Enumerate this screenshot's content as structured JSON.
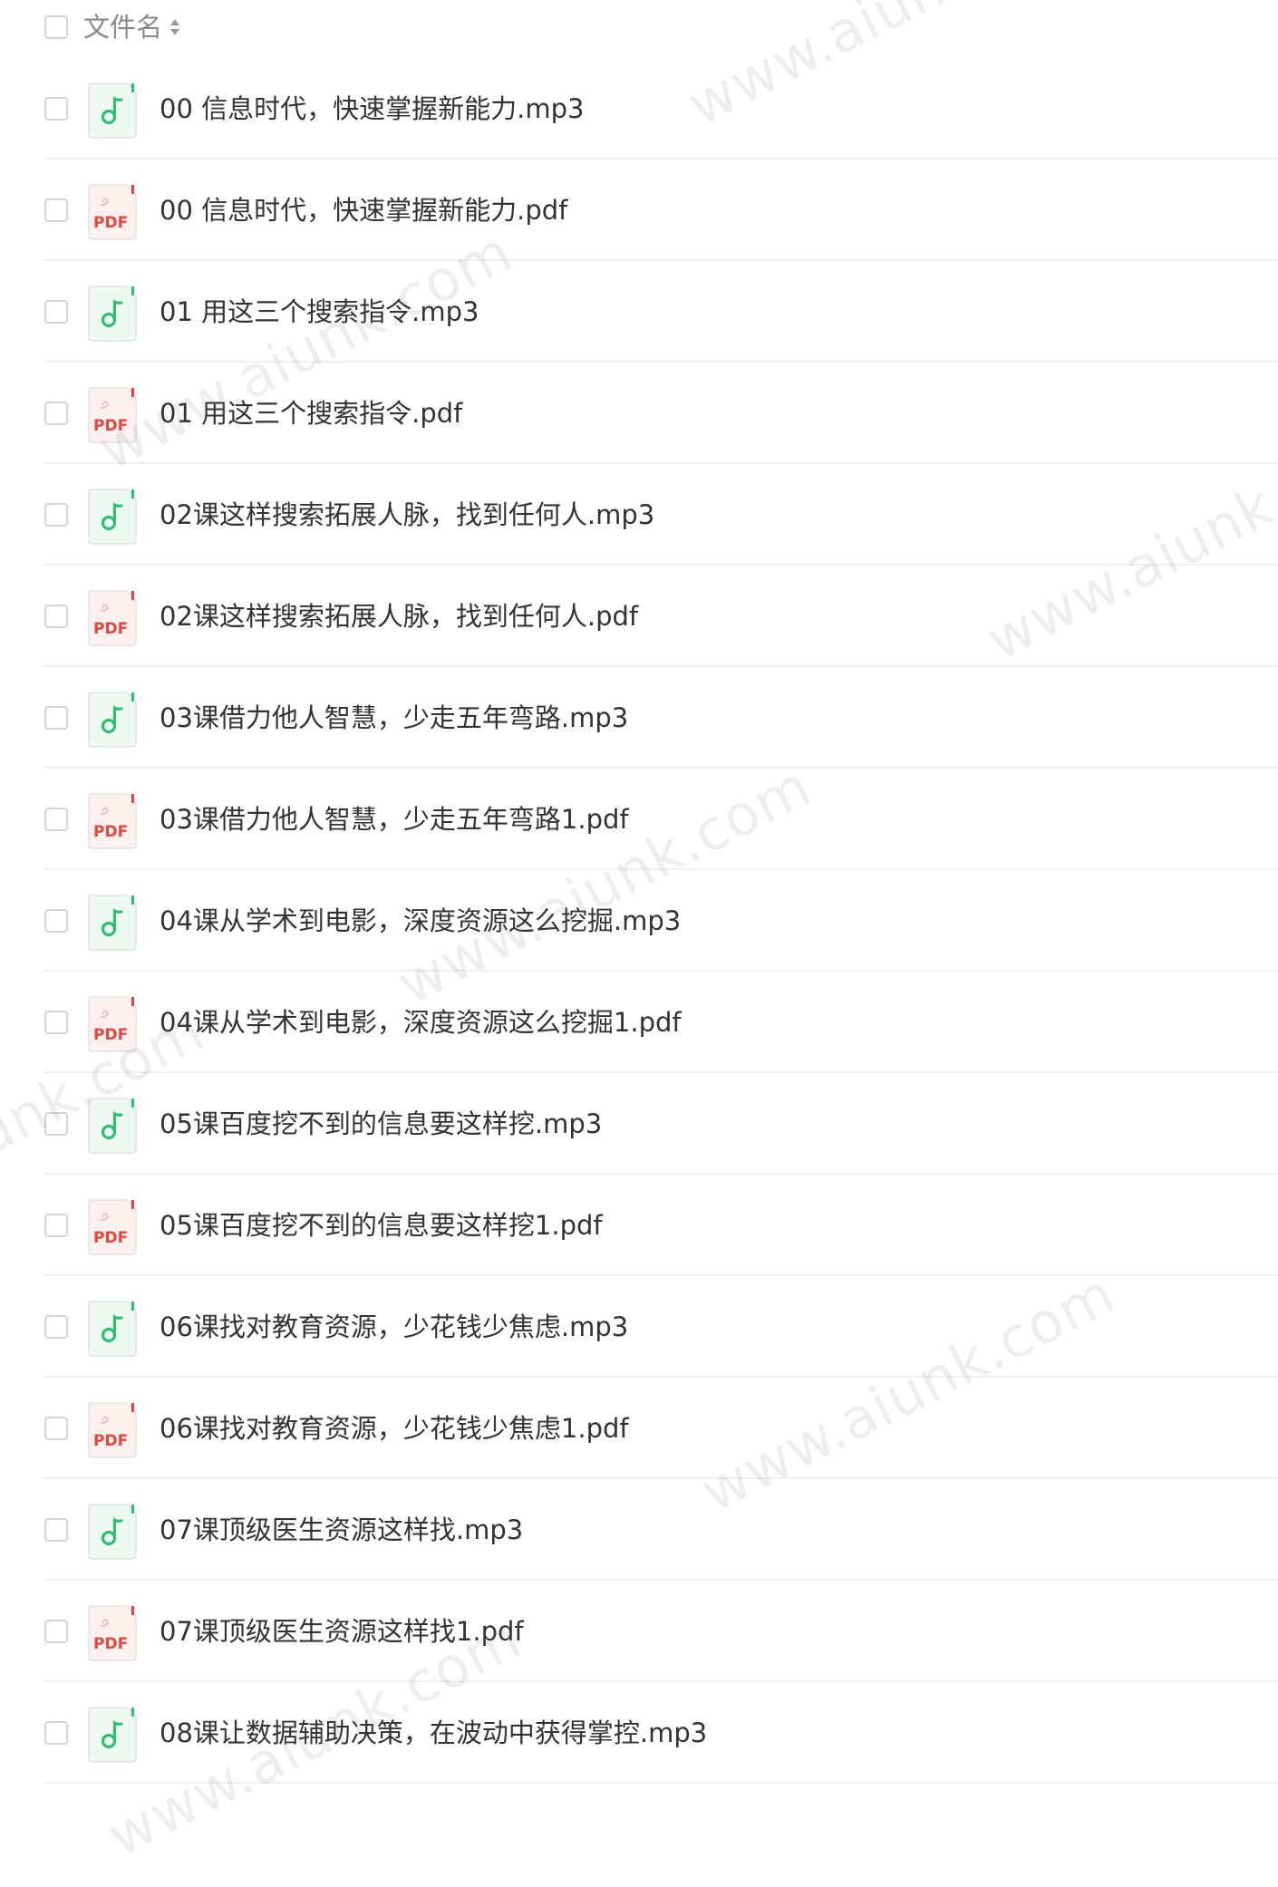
{
  "header": {
    "filename_label": "文件名"
  },
  "icons": {
    "audio": "music-note-icon",
    "pdf": "pdf-file-icon",
    "audio_color": "#2fbf71",
    "pdf_color": "#e2473f"
  },
  "pdf_badge_text": "PDF",
  "files": [
    {
      "name": "00 信息时代，快速掌握新能力.mp3",
      "type": "audio"
    },
    {
      "name": "00 信息时代，快速掌握新能力.pdf",
      "type": "pdf"
    },
    {
      "name": "01 用这三个搜索指令.mp3",
      "type": "audio"
    },
    {
      "name": "01 用这三个搜索指令.pdf",
      "type": "pdf"
    },
    {
      "name": "02课这样搜索拓展人脉，找到任何人.mp3",
      "type": "audio"
    },
    {
      "name": "02课这样搜索拓展人脉，找到任何人.pdf",
      "type": "pdf"
    },
    {
      "name": "03课借力他人智慧，少走五年弯路.mp3",
      "type": "audio"
    },
    {
      "name": "03课借力他人智慧，少走五年弯路1.pdf",
      "type": "pdf"
    },
    {
      "name": "04课从学术到电影，深度资源这么挖掘.mp3",
      "type": "audio"
    },
    {
      "name": "04课从学术到电影，深度资源这么挖掘1.pdf",
      "type": "pdf"
    },
    {
      "name": "05课百度挖不到的信息要这样挖.mp3",
      "type": "audio"
    },
    {
      "name": "05课百度挖不到的信息要这样挖1.pdf",
      "type": "pdf"
    },
    {
      "name": "06课找对教育资源，少花钱少焦虑.mp3",
      "type": "audio"
    },
    {
      "name": "06课找对教育资源，少花钱少焦虑1.pdf",
      "type": "pdf"
    },
    {
      "name": "07课顶级医生资源这样找.mp3",
      "type": "audio"
    },
    {
      "name": "07课顶级医生资源这样找1.pdf",
      "type": "pdf"
    },
    {
      "name": "08课让数据辅助决策，在波动中获得掌控.mp3",
      "type": "audio"
    }
  ],
  "watermark_text": "www.aiunk.com"
}
